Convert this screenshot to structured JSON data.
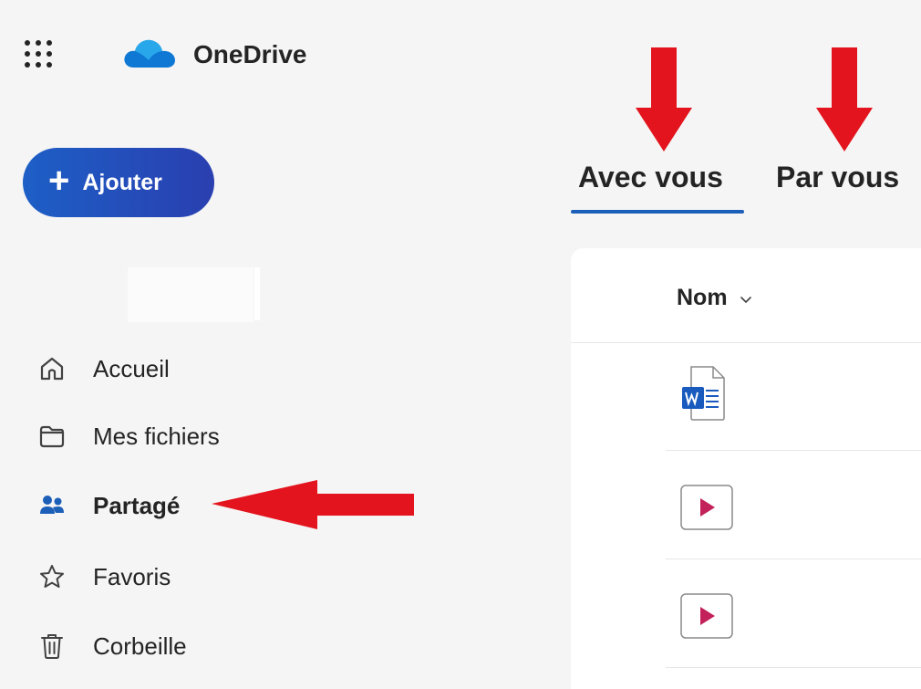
{
  "app": {
    "title": "OneDrive"
  },
  "add_button": {
    "label": "Ajouter"
  },
  "nav": {
    "items": [
      {
        "label": "Accueil",
        "icon": "home-icon"
      },
      {
        "label": "Mes fichiers",
        "icon": "folder-icon"
      },
      {
        "label": "Partagé",
        "icon": "people-icon",
        "active": true
      },
      {
        "label": "Favoris",
        "icon": "star-icon"
      },
      {
        "label": "Corbeille",
        "icon": "trash-icon"
      }
    ]
  },
  "tabs": [
    {
      "label": "Avec vous",
      "selected": true
    },
    {
      "label": "Par vous",
      "selected": false
    }
  ],
  "file_list": {
    "column_header": "Nom",
    "rows": [
      {
        "file_type": "word-document-icon"
      },
      {
        "file_type": "video-file-icon"
      },
      {
        "file_type": "video-file-icon"
      }
    ]
  },
  "colors": {
    "accent": "#1c5fb8",
    "brand_button_start": "#1d5fc6",
    "brand_button_end": "#2a3fb0",
    "annotation_arrow": "#e3141d",
    "video_icon": "#c3215a",
    "word_icon": "#185abd"
  }
}
